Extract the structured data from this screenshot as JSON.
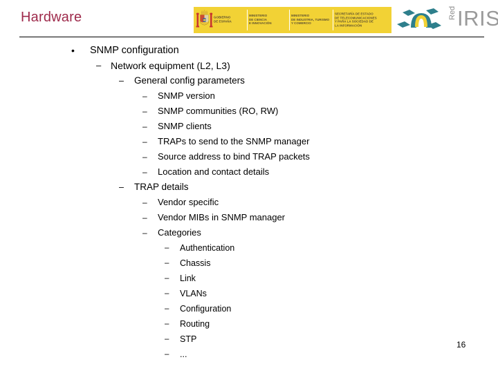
{
  "slide": {
    "title": "Hardware",
    "title_color": "#9e2a4b",
    "number": "16"
  },
  "gov_banner": {
    "background_color": "#f2d235",
    "coat_of_arms_icon": "spanish-coat-of-arms-icon",
    "entities": [
      "GOBIERNO\nDE ESPAÑA",
      "MINISTERIO\nDE CIENCIA\nE INNOVACIÓN",
      "MINISTERIO\nDE INDUSTRIA, TURISMO\nY COMERCIO",
      "SECRETARÍA DE ESTADO\nDE TELECOMUNICACIONES\nY PARA LA SOCIEDAD DE\nLA INFORMACIÓN"
    ]
  },
  "rediris": {
    "mark_icon": "rediris-arch-diamonds-icon",
    "word_red": "Red",
    "word_iris": "IRIS",
    "teal": "#2e7f8c",
    "yellow": "#f2d235"
  },
  "outline": {
    "bullet_glyph_level1": "•",
    "bullet_glyph_dash": "–",
    "items": [
      {
        "level": 1,
        "text": "SNMP configuration"
      },
      {
        "level": 2,
        "text": "Network equipment (L2, L3)"
      },
      {
        "level": 3,
        "text": "General config parameters"
      },
      {
        "level": 4,
        "text": "SNMP version"
      },
      {
        "level": 4,
        "text": "SNMP communities (RO, RW)"
      },
      {
        "level": 4,
        "text": "SNMP clients"
      },
      {
        "level": 4,
        "text": "TRAPs to send to the SNMP manager"
      },
      {
        "level": 4,
        "text": "Source address to bind TRAP packets"
      },
      {
        "level": 4,
        "text": "Location and contact details"
      },
      {
        "level": 3,
        "text": "TRAP details"
      },
      {
        "level": 4,
        "text": "Vendor specific"
      },
      {
        "level": 4,
        "text": "Vendor MIBs in SNMP manager"
      },
      {
        "level": 4,
        "text": "Categories"
      },
      {
        "level": 5,
        "text": "Authentication"
      },
      {
        "level": 5,
        "text": "Chassis"
      },
      {
        "level": 5,
        "text": "Link"
      },
      {
        "level": 5,
        "text": "VLANs"
      },
      {
        "level": 5,
        "text": "Configuration"
      },
      {
        "level": 5,
        "text": "Routing"
      },
      {
        "level": 5,
        "text": "STP"
      },
      {
        "level": 5,
        "text": "..."
      }
    ]
  }
}
